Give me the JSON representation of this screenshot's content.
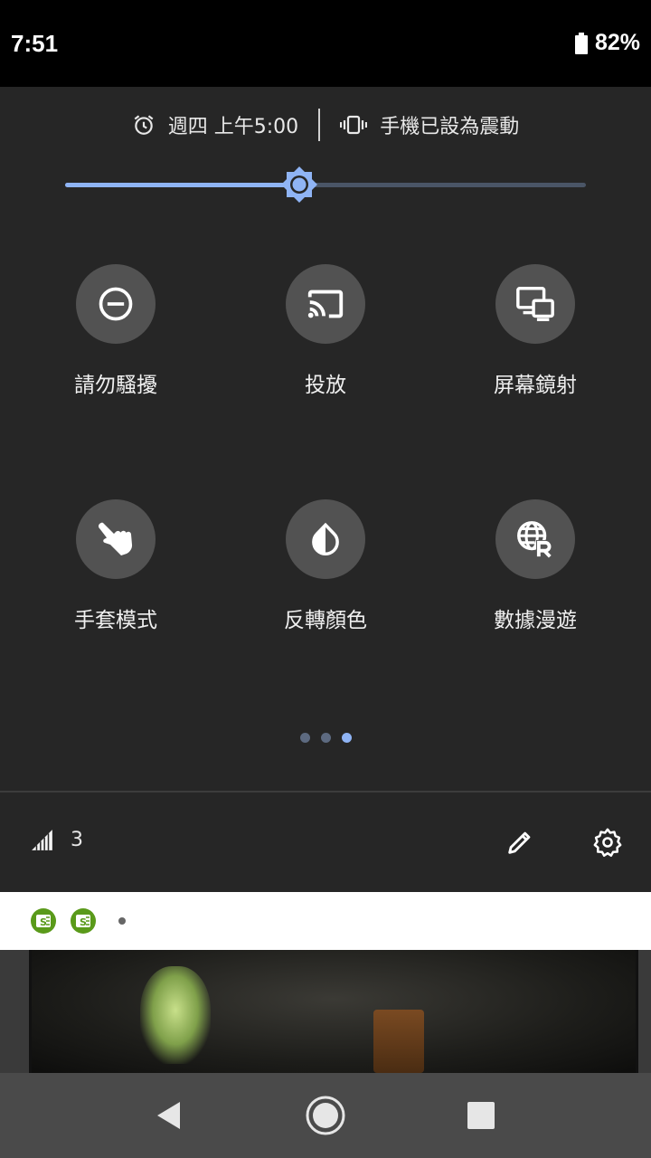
{
  "status_bar": {
    "time": "7:51",
    "battery_percent": "82%",
    "battery_icon": "battery-icon"
  },
  "header": {
    "alarm_icon": "alarm-icon",
    "alarm_text": "週四 上午5:00",
    "vibrate_icon": "vibrate-icon",
    "ringer_text": "手機已設為震動"
  },
  "brightness": {
    "level": 0.45,
    "icon": "brightness-icon"
  },
  "tiles": [
    {
      "label": "請勿騷擾",
      "icon": "do-not-disturb-icon"
    },
    {
      "label": "投放",
      "icon": "cast-icon"
    },
    {
      "label": "屏幕鏡射",
      "icon": "screen-mirroring-icon"
    },
    {
      "label": "手套模式",
      "icon": "glove-mode-icon"
    },
    {
      "label": "反轉顏色",
      "icon": "invert-colors-icon"
    },
    {
      "label": "數據漫遊",
      "icon": "data-roaming-icon"
    }
  ],
  "pager": {
    "pages": 3,
    "current_page": 3
  },
  "footer": {
    "signal_icon": "signal-icon",
    "carrier": "3",
    "edit_icon": "edit-icon",
    "settings_icon": "settings-icon"
  },
  "notifications": {
    "icons": [
      "app-notification-icon",
      "app-notification-icon"
    ],
    "more_indicator": "more-dot"
  },
  "nav_bar": {
    "back": "back-icon",
    "home": "home-icon",
    "recents": "recents-icon"
  },
  "colors": {
    "accent": "#8fb4f5",
    "panel_bg": "#262626",
    "tile_bg": "#525252"
  }
}
